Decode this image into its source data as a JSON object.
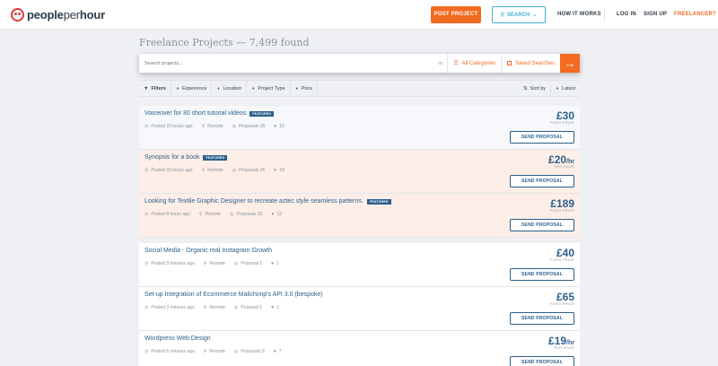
{
  "nav": {
    "logo": {
      "part1": "people",
      "part2": "per",
      "part3": "hour"
    },
    "post_project": "POST PROJECT",
    "search": "SEARCH",
    "how_it_works": "HOW IT WORKS",
    "log_in": "LOG IN",
    "sign_up": "SIGN UP",
    "freelancer": "FREELANCER?"
  },
  "heading": "Freelance Projects — 7,499 found",
  "search": {
    "placeholder": "Search projects...",
    "in_label": "in:",
    "categories": "All Categories",
    "saved": "Saved Searches"
  },
  "filters": {
    "filters_label": "Filters",
    "items": [
      "Experience",
      "Location",
      "Project Type",
      "Price"
    ],
    "sort_by": "Sort by",
    "latest": "Latest"
  },
  "colors": {
    "accent": "#f26b21",
    "brand_blue": "#2b5f8c",
    "search_blue": "#3fb3d1"
  },
  "featured_projects": [
    {
      "title": "Voiceover for 30 short tutorial videos",
      "badge": "FEATURED",
      "posted": "Posted 23 hours ago",
      "location": "Remote",
      "proposals": "Proposals 30",
      "likes": "16",
      "price": "£30",
      "price_suffix": "",
      "price_type": "FIXED PRICE",
      "action": "SEND PROPOSAL",
      "style": "feat-blue"
    },
    {
      "title": "Synopsis for a book",
      "badge": "FEATURED",
      "posted": "Posted 23 hours ago",
      "location": "Remote",
      "proposals": "Proposals 26",
      "likes": "18",
      "price": "£20",
      "price_suffix": "/hr",
      "price_type": "PER HOUR",
      "action": "SEND PROPOSAL",
      "style": "feat-pink"
    },
    {
      "title": "Looking for Textile Graphic Designer to recreate aztec style seamless patterns.",
      "badge": "FEATURED",
      "posted": "Posted 8 hours ago",
      "location": "Remote",
      "proposals": "Proposals 22",
      "likes": "12",
      "price": "£189",
      "price_suffix": "",
      "price_type": "FIXED PRICE",
      "action": "SEND PROPOSAL",
      "style": "feat-pink"
    }
  ],
  "projects": [
    {
      "title": "Social Media - Organic real Instagram Growth",
      "badge": "",
      "posted": "Posted 3 minutes ago",
      "location": "Remote",
      "proposals": "Proposal 1",
      "likes": "1",
      "price": "£40",
      "price_suffix": "",
      "price_type": "FIXED PRICE",
      "action": "SEND PROPOSAL",
      "style": "plain"
    },
    {
      "title": "Set-up Integration of Ecommerce Mailchimp's API 3.0 (bespoke)",
      "badge": "",
      "posted": "Posted 3 minutes ago",
      "location": "Remote",
      "proposals": "Proposal 1",
      "likes": "1",
      "price": "£65",
      "price_suffix": "",
      "price_type": "FIXED PRICE",
      "action": "SEND PROPOSAL",
      "style": "plain"
    },
    {
      "title": "Wordpress Web Design",
      "badge": "",
      "posted": "Posted 6 minutes ago",
      "location": "Remote",
      "proposals": "Proposals 9",
      "likes": "7",
      "price": "£19",
      "price_suffix": "/hr",
      "price_type": "PER HOUR",
      "action": "SEND PROPOSAL",
      "style": "plain"
    }
  ]
}
